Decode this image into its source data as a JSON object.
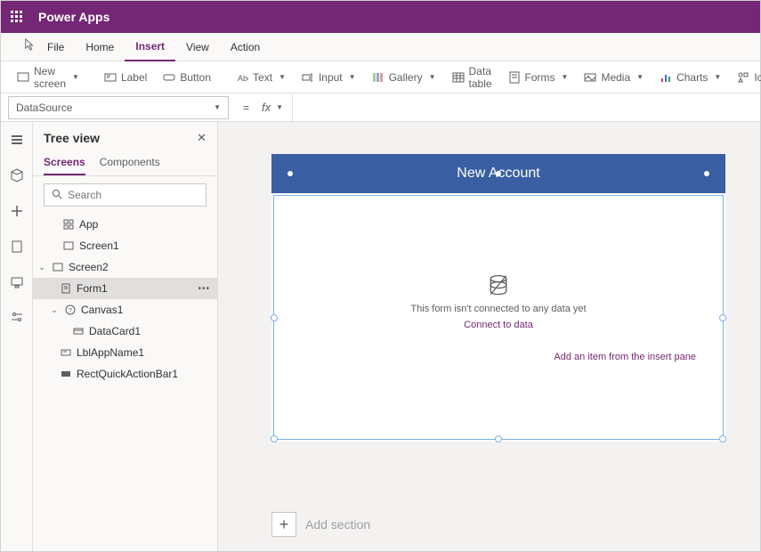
{
  "app": {
    "title": "Power Apps"
  },
  "menu": {
    "file": "File",
    "home": "Home",
    "insert": "Insert",
    "view": "View",
    "action": "Action"
  },
  "ribbon": {
    "new_screen": "New screen",
    "label": "Label",
    "button": "Button",
    "text": "Text",
    "input": "Input",
    "gallery": "Gallery",
    "data_table": "Data table",
    "forms": "Forms",
    "media": "Media",
    "charts": "Charts",
    "icons": "Icons"
  },
  "formula": {
    "property": "DataSource",
    "value": ""
  },
  "tree": {
    "title": "Tree view",
    "tabs": {
      "screens": "Screens",
      "components": "Components"
    },
    "search_placeholder": "Search",
    "nodes": {
      "app": "App",
      "screen1": "Screen1",
      "screen2": "Screen2",
      "form1": "Form1",
      "canvas1": "Canvas1",
      "datacard1": "DataCard1",
      "lblappname1": "LblAppName1",
      "rectquick1": "RectQuickActionBar1"
    }
  },
  "canvas": {
    "header_title": "New Account",
    "form_message": "This form isn't connected to any data yet",
    "connect_link": "Connect to data",
    "insert_link": "Add an item from the insert pane",
    "add_section": "Add section"
  }
}
